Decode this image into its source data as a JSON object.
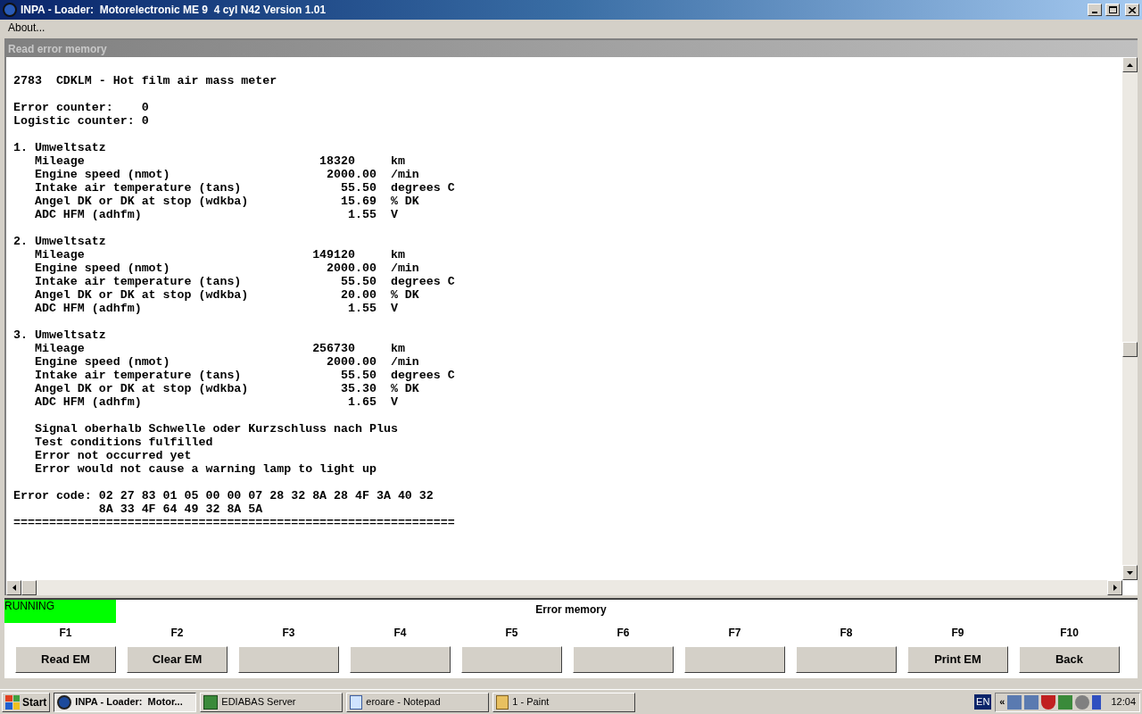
{
  "window": {
    "title": "INPA - Loader:  Motorelectronic ME 9  4 cyl N42 Version 1.01"
  },
  "menu": [
    "About..."
  ],
  "panel": {
    "title": "Read error memory"
  },
  "blocks": [
    {
      "lines": [
        "2783  CDKLM - Hot film air mass meter"
      ]
    },
    {
      "lines": [
        "Error counter:    0",
        "Logistic counter: 0"
      ]
    },
    {
      "lines": [
        "1. Umweltsatz",
        "   Mileage                                 18320     km",
        "   Engine speed (nmot)                      2000.00  /min",
        "   Intake air temperature (tans)              55.50  degrees C",
        "   Angel DK or DK at stop (wdkba)             15.69  % DK",
        "   ADC HFM (adhfm)                             1.55  V"
      ]
    },
    {
      "lines": [
        "2. Umweltsatz",
        "   Mileage                                149120     km",
        "   Engine speed (nmot)                      2000.00  /min",
        "   Intake air temperature (tans)              55.50  degrees C",
        "   Angel DK or DK at stop (wdkba)             20.00  % DK",
        "   ADC HFM (adhfm)                             1.55  V"
      ]
    },
    {
      "lines": [
        "3. Umweltsatz",
        "   Mileage                                256730     km",
        "   Engine speed (nmot)                      2000.00  /min",
        "   Intake air temperature (tans)              55.50  degrees C",
        "   Angel DK or DK at stop (wdkba)             35.30  % DK",
        "   ADC HFM (adhfm)                             1.65  V"
      ]
    },
    {
      "lines": [
        "   Signal oberhalb Schwelle oder Kurzschluss nach Plus",
        "   Test conditions fulfilled",
        "   Error not occurred yet",
        "   Error would not cause a warning lamp to light up"
      ]
    },
    {
      "lines": [
        "Error code: 02 27 83 01 05 00 00 07 28 32 8A 28 4F 3A 40 32",
        "            8A 33 4F 64 49 32 8A 5A",
        "=============================================================="
      ]
    }
  ],
  "status": {
    "state": "RUNNING",
    "running": true,
    "title": "Error memory"
  },
  "function_keys": [
    {
      "key": "F1",
      "label": "Read EM"
    },
    {
      "key": "F2",
      "label": "Clear EM"
    },
    {
      "key": "F3"
    },
    {
      "key": "F4"
    },
    {
      "key": "F5"
    },
    {
      "key": "F6"
    },
    {
      "key": "F7"
    },
    {
      "key": "F8"
    },
    {
      "key": "F9",
      "label": "Print EM"
    },
    {
      "key": "F10",
      "label": "Back"
    }
  ],
  "taskbar": {
    "start": "Start",
    "tasks": [
      {
        "label": "INPA - Loader:  Motor...",
        "selected": true
      },
      {
        "label": "EDIABAS Server",
        "selected": false
      },
      {
        "label": "eroare - Notepad",
        "selected": false
      },
      {
        "label": "1 - Paint",
        "selected": false
      }
    ],
    "language": "EN",
    "tray_expand": "«",
    "time": "12:04"
  }
}
